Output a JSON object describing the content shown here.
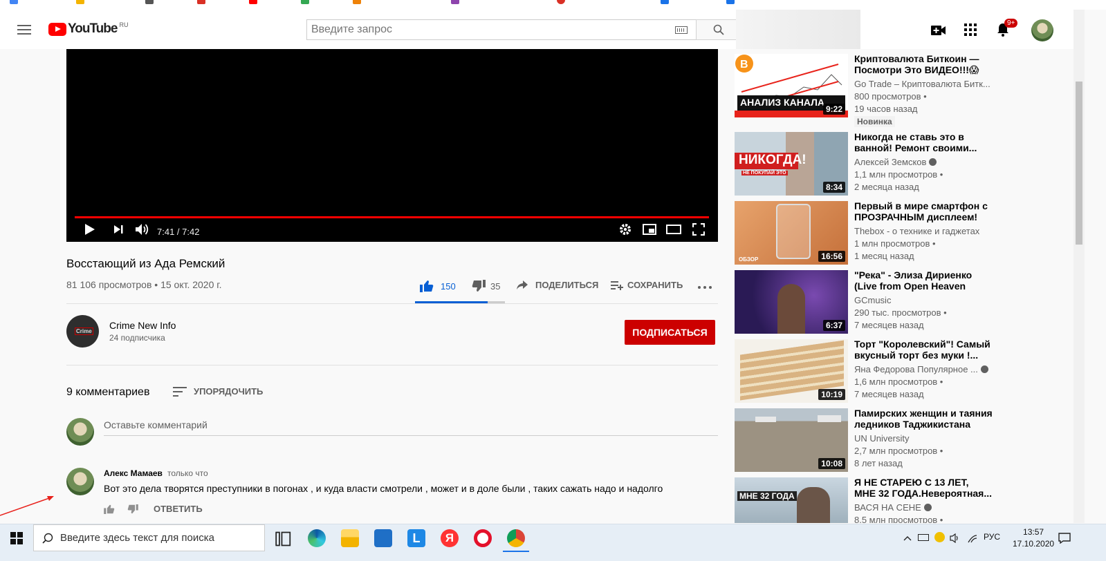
{
  "masthead": {
    "logo_text": "YouTube",
    "country": "RU",
    "search_placeholder": "Введите запрос",
    "notification_count": "9+"
  },
  "player": {
    "time": "7:41 / 7:42",
    "progress": 0.998
  },
  "video": {
    "title": "Восстающий из Ада Ремский",
    "meta": "81 106 просмотров • 15 окт. 2020 г.",
    "likes": "150",
    "dislikes": "35",
    "share_label": "ПОДЕЛИТЬСЯ",
    "save_label": "СОХРАНИТЬ",
    "like_ratio": 0.81
  },
  "channel": {
    "name": "Crime New Info",
    "subscribers": "24 подписчика",
    "subscribe_label": "ПОДПИСАТЬСЯ"
  },
  "comments": {
    "count_label": "9 комментариев",
    "sort_label": "УПОРЯДОЧИТЬ",
    "add_placeholder": "Оставьте комментарий",
    "items": [
      {
        "author": "Алекс Мамаев",
        "time": "только что",
        "text": "Вот это дела творятся преступники в погонах , и куда власти смотрели , может и в доле были , таких сажать надо и надолго",
        "reply_label": "ОТВЕТИТЬ"
      }
    ]
  },
  "recommendations": [
    {
      "title": "Криптовалюта Биткоин — Посмотри Это ВИДЕО!!!😱",
      "channel": "Go Trade – Криптовалюта Битк...",
      "views": "800 просмотров •",
      "age": "19 часов назад",
      "badge": "Новинка",
      "duration": "9:22",
      "thumb_text": "АНАЛИЗ КАНАЛА",
      "verified": false
    },
    {
      "title": "Никогда не ставь это в ванной! Ремонт своими...",
      "channel": "Алексей Земсков",
      "views": "1,1 млн просмотров •",
      "age": "2 месяца назад",
      "badge": "",
      "duration": "8:34",
      "thumb_text": "НИКОГДА!",
      "thumb_sub": "НЕ ПОКУПАЙ ЭТО",
      "verified": true
    },
    {
      "title": "Первый в мире смартфон с ПРОЗРАЧНЫМ дисплеем!",
      "channel": "Thebox - о технике и гаджетах",
      "views": "1 млн просмотров •",
      "age": "1 месяц назад",
      "badge": "",
      "duration": "16:56",
      "thumb_text": "ОБЗОР",
      "verified": false
    },
    {
      "title": "\"Река\" - Элиза Дириенко (Live from Open Heaven Conferenc...",
      "channel": "GCmusic",
      "views": "290 тыс. просмотров •",
      "age": "7 месяцев назад",
      "badge": "",
      "duration": "6:37",
      "verified": false
    },
    {
      "title": "Торт \"Королевский\"! Самый вкусный торт без муки !...",
      "channel": "Яна Федорова Популярное ...",
      "views": "1,6 млн просмотров •",
      "age": "7 месяцев назад",
      "badge": "",
      "duration": "10:19",
      "verified": true
    },
    {
      "title": "Памирских женщин и таяния ледников Таджикистана",
      "channel": "UN University",
      "views": "2,7 млн просмотров •",
      "age": "8 лет назад",
      "badge": "",
      "duration": "10:08",
      "verified": false
    },
    {
      "title": "Я НЕ СТАРЕЮ С 13 ЛЕТ, МНЕ 32 ГОДА.Невероятная...",
      "channel": "ВАСЯ НА СЕНЕ",
      "views": "8,5 млн просмотров •",
      "age": "",
      "badge": "",
      "duration": "",
      "thumb_text": "МНЕ 32 ГОДА",
      "verified": true
    }
  ],
  "taskbar": {
    "search_placeholder": "Введите здесь текст для поиска",
    "language": "РУС",
    "time": "13:57",
    "date": "17.10.2020"
  },
  "colors": {
    "accent_red": "#ff0000",
    "subscribe_red": "#cc0000",
    "like_blue": "#065fd4"
  }
}
